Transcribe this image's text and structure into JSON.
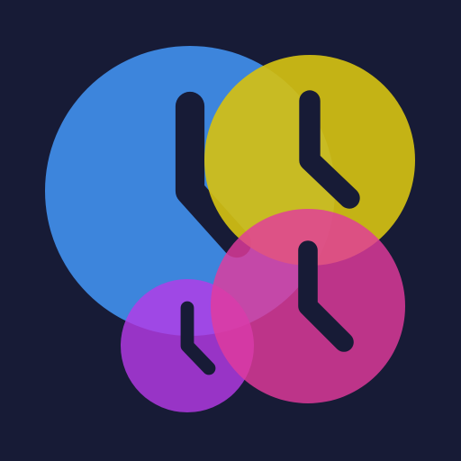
{
  "icon": {
    "name": "multiple-clocks-app-icon",
    "colors": {
      "background": "#171b36",
      "hands": "#171b36",
      "blue_clock": "#3f8be6",
      "yellow_clock": "#d4c012",
      "pink_clock": "#e23a9c",
      "purple_clock": "#b43be6"
    },
    "clocks": [
      {
        "id": "blue",
        "icon_name": "clock-icon",
        "color_key": "blue_clock",
        "opacity": 0.95
      },
      {
        "id": "yellow",
        "icon_name": "clock-icon",
        "color_key": "yellow_clock",
        "opacity": 0.92
      },
      {
        "id": "pink",
        "icon_name": "clock-icon",
        "color_key": "pink_clock",
        "opacity": 0.82
      },
      {
        "id": "purple",
        "icon_name": "clock-icon",
        "color_key": "purple_clock",
        "opacity": 0.82
      }
    ]
  }
}
